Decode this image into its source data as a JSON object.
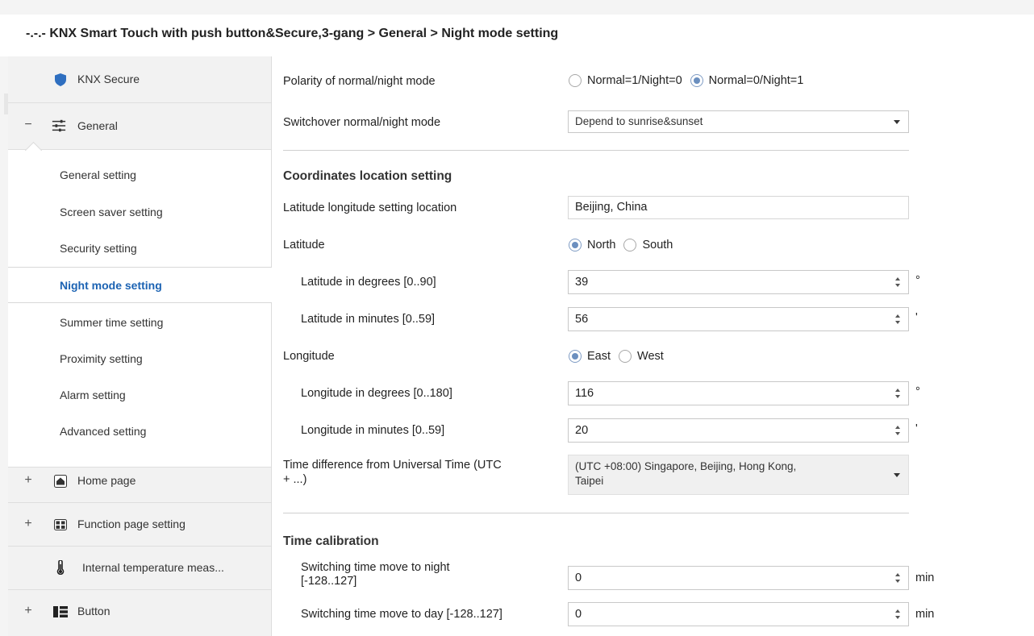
{
  "header": {
    "title": "-.-.- KNX Smart Touch with push button&Secure,3-gang > General > Night mode setting"
  },
  "sidebar": {
    "knx_secure": {
      "label": "KNX Secure",
      "icon": "shield-icon"
    },
    "general": {
      "label": "General",
      "sign": "−",
      "icon": "sliders-icon"
    },
    "sub_items": [
      {
        "label": "General setting"
      },
      {
        "label": "Screen saver setting"
      },
      {
        "label": "Security setting"
      },
      {
        "label": "Night mode setting"
      },
      {
        "label": "Summer time setting"
      },
      {
        "label": "Proximity setting"
      },
      {
        "label": "Alarm setting"
      },
      {
        "label": "Advanced setting"
      }
    ],
    "home_page": {
      "label": "Home page",
      "sign": "+",
      "icon": "home-icon"
    },
    "function_page": {
      "label": "Function page setting",
      "sign": "+",
      "icon": "grid-icon"
    },
    "internal_temp": {
      "label": "Internal temperature meas...",
      "icon": "thermometer-icon"
    },
    "button": {
      "label": "Button",
      "sign": "+",
      "icon": "button-list-icon"
    }
  },
  "main": {
    "polarity": {
      "label": "Polarity of normal/night mode",
      "opt1": "Normal=1/Night=0",
      "opt2": "Normal=0/Night=1",
      "selected": 2
    },
    "switchover": {
      "label": "Switchover normal/night mode",
      "value": "Depend to sunrise&sunset"
    },
    "coords_heading": "Coordinates location setting",
    "location": {
      "label": "Latitude longitude setting location",
      "value": "Beijing, China"
    },
    "latitude": {
      "label": "Latitude",
      "opt1": "North",
      "opt2": "South",
      "selected": 1
    },
    "lat_deg": {
      "label": "Latitude in degrees [0..90]",
      "value": "39",
      "unit": "°"
    },
    "lat_min": {
      "label": "Latitude in minutes [0..59]",
      "value": "56",
      "unit": "'"
    },
    "longitude": {
      "label": "Longitude",
      "opt1": "East",
      "opt2": "West",
      "selected": 1
    },
    "lon_deg": {
      "label": "Longitude in degrees [0..180]",
      "value": "116",
      "unit": "°"
    },
    "lon_min": {
      "label": "Longitude in minutes [0..59]",
      "value": "20",
      "unit": "'"
    },
    "time_diff": {
      "label_line1": "Time difference from Universal Time (UTC",
      "label_line2": "+ ...)",
      "value_line1": "(UTC +08:00) Singapore,  Beijing, Hong Kong,",
      "value_line2": "Taipei"
    },
    "calib_heading": "Time calibration",
    "night_move": {
      "label_line1": "Switching time move to night",
      "label_line2": "[-128..127]",
      "value": "0",
      "unit": "min"
    },
    "day_move": {
      "label": "Switching time move to day [-128..127]",
      "value": "0",
      "unit": "min"
    }
  }
}
